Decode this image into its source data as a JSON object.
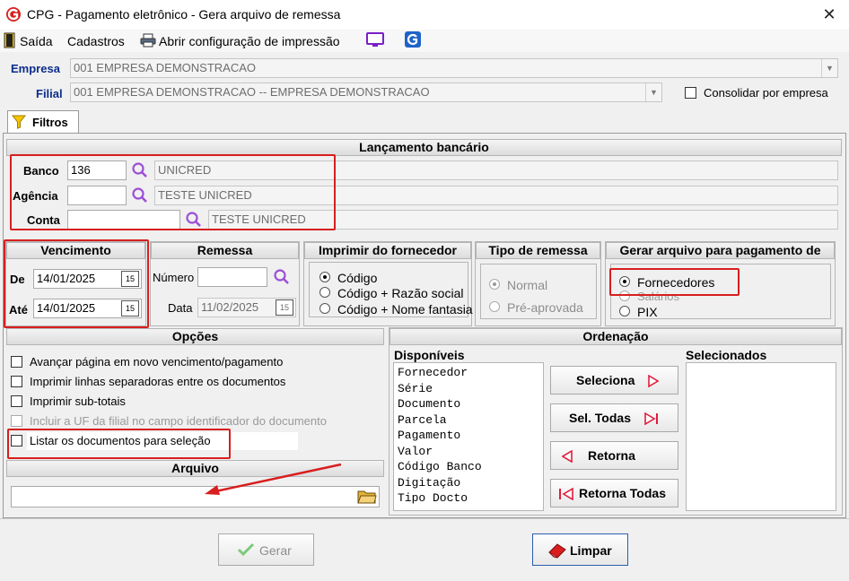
{
  "window": {
    "title": "CPG -  Pagamento eletrônico - Gera arquivo de remessa",
    "close_glyph": "✕"
  },
  "menu": {
    "exit": "Saída",
    "registers": "Cadastros",
    "print_config": "Abrir configuração de impressão"
  },
  "empresa": {
    "label": "Empresa",
    "value": "001 EMPRESA DEMONSTRACAO"
  },
  "filial": {
    "label": "Filial",
    "value": "001 EMPRESA DEMONSTRACAO -- EMPRESA DEMONSTRACAO",
    "consolidate_label": "Consolidar por empresa"
  },
  "tab": {
    "filters": "Filtros"
  },
  "bank": {
    "heading": "Lançamento bancário",
    "banco_label": "Banco",
    "banco_code": "136",
    "banco_name": "UNICRED",
    "agencia_label": "Agência",
    "agencia_name": "TESTE UNICRED",
    "conta_label": "Conta",
    "conta_name": "TESTE UNICRED"
  },
  "vencimento": {
    "heading": "Vencimento",
    "from_label": "De",
    "from": "14/01/2025",
    "to_label": "Até",
    "to": "14/01/2025"
  },
  "remessa": {
    "heading": "Remessa",
    "number_label": "Número",
    "number": "",
    "date_label": "Data",
    "date": "11/02/2025"
  },
  "imprimir": {
    "heading": "Imprimir do fornecedor",
    "options": [
      "Código",
      "Código + Razão social",
      "Código + Nome fantasia"
    ],
    "selected": 0
  },
  "tipo_remessa": {
    "heading": "Tipo de remessa",
    "options": [
      "Normal",
      "Pré-aprovada"
    ],
    "selected": 0
  },
  "gerar": {
    "heading": "Gerar arquivo para pagamento de",
    "options": [
      "Fornecedores",
      "Salários",
      "PIX"
    ],
    "selected": 0
  },
  "opcoes": {
    "heading": "Opções",
    "items": [
      "Avançar página em novo vencimento/pagamento",
      "Imprimir linhas separadoras entre os documentos",
      "Imprimir sub-totais",
      "Incluir a UF da filial no campo identificador do documento",
      "Listar os documentos para seleção"
    ]
  },
  "arquivo": {
    "heading": "Arquivo",
    "value": ""
  },
  "ordenacao": {
    "heading": "Ordenação",
    "available_label": "Disponíveis",
    "selected_label": "Selecionados",
    "available": [
      "Fornecedor",
      "Série",
      "Documento",
      "Parcela",
      "Pagamento",
      "Valor",
      "Código Banco",
      "Digitação",
      "Tipo Docto"
    ],
    "buttons": {
      "select": "Seleciona",
      "select_all": "Sel. Todas",
      "back": "Retorna",
      "back_all": "Retorna Todas"
    }
  },
  "footer": {
    "generate": "Gerar",
    "clear": "Limpar"
  },
  "colors": {
    "accent_red": "#d81e1e",
    "label_blue": "#0b2d8c",
    "magnifier": "#9b4fd6"
  }
}
